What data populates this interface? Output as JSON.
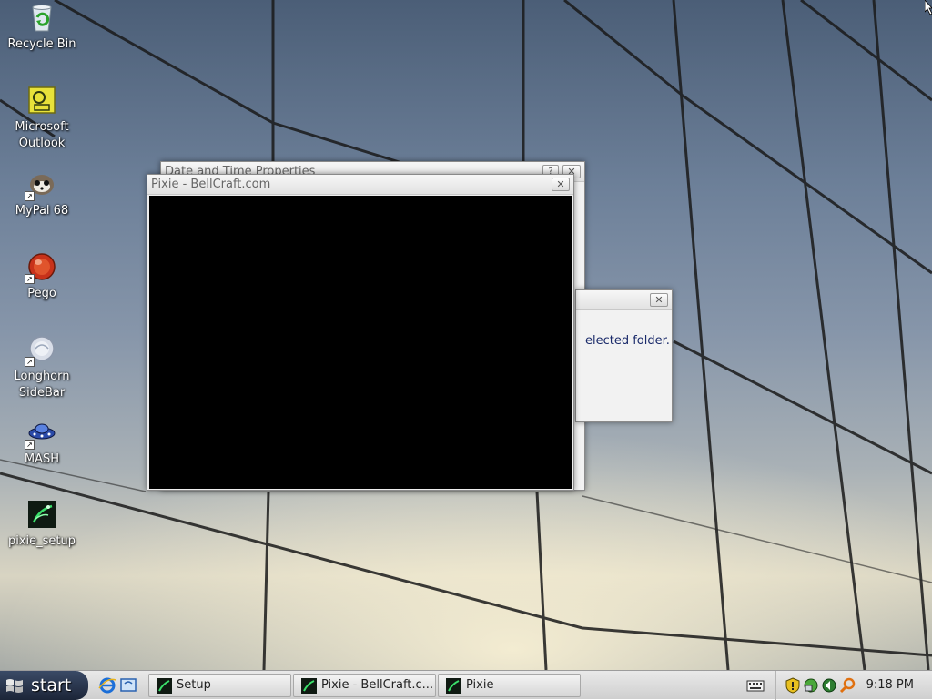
{
  "desktop_icons": [
    {
      "label": "Recycle Bin",
      "icon": "recycle-bin-icon",
      "shortcut": false
    },
    {
      "label": "Microsoft Outlook",
      "icon": "outlook-icon",
      "shortcut": false
    },
    {
      "label": "MyPal 68",
      "icon": "mypal-browser-icon",
      "shortcut": true
    },
    {
      "label": "Pego",
      "icon": "pego-icon",
      "shortcut": true
    },
    {
      "label": "Longhorn SideBar",
      "icon": "longhorn-sidebar-icon",
      "shortcut": true
    },
    {
      "label": "MASH",
      "icon": "mash-icon",
      "shortcut": true
    },
    {
      "label": "pixie_setup",
      "icon": "pixie-setup-icon",
      "shortcut": false
    }
  ],
  "windows": {
    "datetime": {
      "title": "Date and Time Properties",
      "help_glyph": "?",
      "close_glyph": "✕"
    },
    "folder_dialog": {
      "message_fragment": "elected folder.",
      "close_glyph": "✕"
    },
    "pixie": {
      "title": "Pixie - BellCraft.com",
      "close_glyph": "✕"
    }
  },
  "taskbar": {
    "start_label": "start",
    "quick_launch": [
      "internet-explorer-icon",
      "show-desktop-icon"
    ],
    "tasks": [
      {
        "label": "Setup",
        "icon": "pixie-app-icon"
      },
      {
        "label": "Pixie - BellCraft.c...",
        "icon": "pixie-app-icon"
      },
      {
        "label": "Pixie",
        "icon": "pixie-app-icon"
      }
    ],
    "tray_icons": [
      "keyboard-icon",
      "security-shield-icon",
      "network-icon",
      "volume-icon",
      "search-icon"
    ],
    "clock": "9:18 PM"
  },
  "colors": {
    "taskbar_bg": "#d8d8d8",
    "start_bg": "#24304a",
    "pixie_canvas": "#000000",
    "dialog_text": "#1a2a6a"
  }
}
